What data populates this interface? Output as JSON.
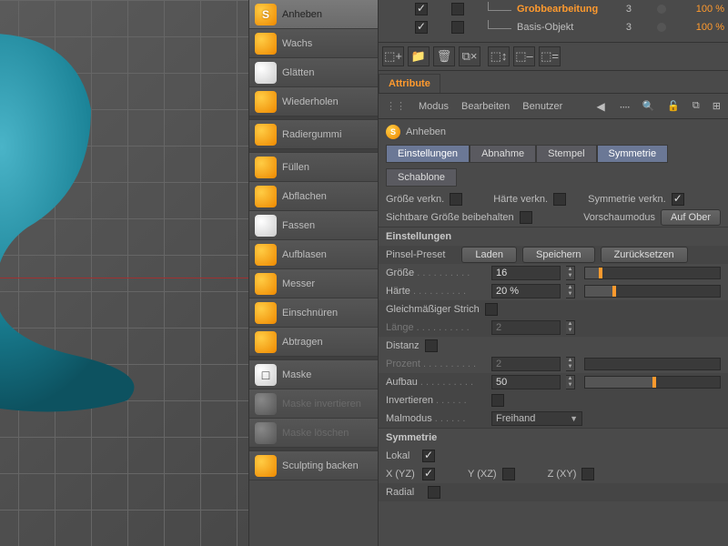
{
  "viewport": {
    "object_color": "#1a8296"
  },
  "tools": [
    {
      "label": "Anheben",
      "icon": "orange",
      "mod": "s",
      "sel": true
    },
    {
      "label": "Wachs",
      "icon": "orange"
    },
    {
      "label": "Glätten",
      "icon": "white"
    },
    {
      "label": "Wiederholen",
      "icon": "orange"
    },
    {
      "sep": true
    },
    {
      "label": "Radiergummi",
      "icon": "orange"
    },
    {
      "sep": true
    },
    {
      "label": "Füllen",
      "icon": "orange"
    },
    {
      "label": "Abflachen",
      "icon": "orange"
    },
    {
      "label": "Fassen",
      "icon": "white"
    },
    {
      "label": "Aufblasen",
      "icon": "orange"
    },
    {
      "label": "Messer",
      "icon": "orange"
    },
    {
      "label": "Einschnüren",
      "icon": "orange"
    },
    {
      "label": "Abtragen",
      "icon": "orange"
    },
    {
      "sep": true
    },
    {
      "label": "Maske",
      "icon": "white",
      "mod": "m"
    },
    {
      "label": "Maske invertieren",
      "icon": "gray",
      "disabled": true
    },
    {
      "label": "Maske löschen",
      "icon": "gray",
      "disabled": true
    },
    {
      "sep": true
    },
    {
      "label": "Sculpting backen",
      "icon": "orange",
      "disabled": false
    }
  ],
  "hierarchy": [
    {
      "vis": true,
      "chk": false,
      "name": "Grobbearbeitung",
      "active": true,
      "num": "3",
      "dot": false,
      "pct": "100 %"
    },
    {
      "vis": true,
      "chk": false,
      "name": "Basis-Objekt",
      "active": false,
      "num": "3",
      "dot": false,
      "pct": "100 %"
    }
  ],
  "iconbar": [
    "⬚+",
    "📁",
    "🗑",
    "⧉×",
    "⬚↕",
    "⬚–",
    "⬚="
  ],
  "attribute": {
    "tab": "Attribute",
    "menu": [
      "Modus",
      "Bearbeiten",
      "Benutzer"
    ],
    "head": "Anheben",
    "subtabs": [
      {
        "t": "Einstellungen",
        "a": true
      },
      {
        "t": "Abnahme"
      },
      {
        "t": "Stempel"
      },
      {
        "t": "Symmetrie",
        "a": true
      }
    ],
    "subtabs2": [
      {
        "t": "Schablone"
      }
    ],
    "link_size": "Größe verkn.",
    "link_hard": "Härte verkn.",
    "link_sym": "Symmetrie verkn.",
    "keep_vis": "Sichtbare Größe beibehalten",
    "preview": "Vorschaumodus",
    "preview_btn": "Auf Ober",
    "group_settings": "Einstellungen",
    "preset": "Pinsel-Preset",
    "load": "Laden",
    "save": "Speichern",
    "reset": "Zurücksetzen",
    "size": "Größe",
    "size_v": "16",
    "hard": "Härte",
    "hard_v": "20 %",
    "even": "Gleichmäßiger Strich",
    "len": "Länge",
    "len_v": "2",
    "dist": "Distanz",
    "pct": "Prozent",
    "pct_v": "2",
    "buildup": "Aufbau",
    "buildup_v": "50",
    "invert": "Invertieren",
    "paint": "Malmodus",
    "paint_v": "Freihand",
    "group_sym": "Symmetrie",
    "local": "Lokal",
    "xyz": "X (YZ)",
    "yxz": "Y (XZ)",
    "zxy": "Z (XY)",
    "radial": "Radial"
  }
}
